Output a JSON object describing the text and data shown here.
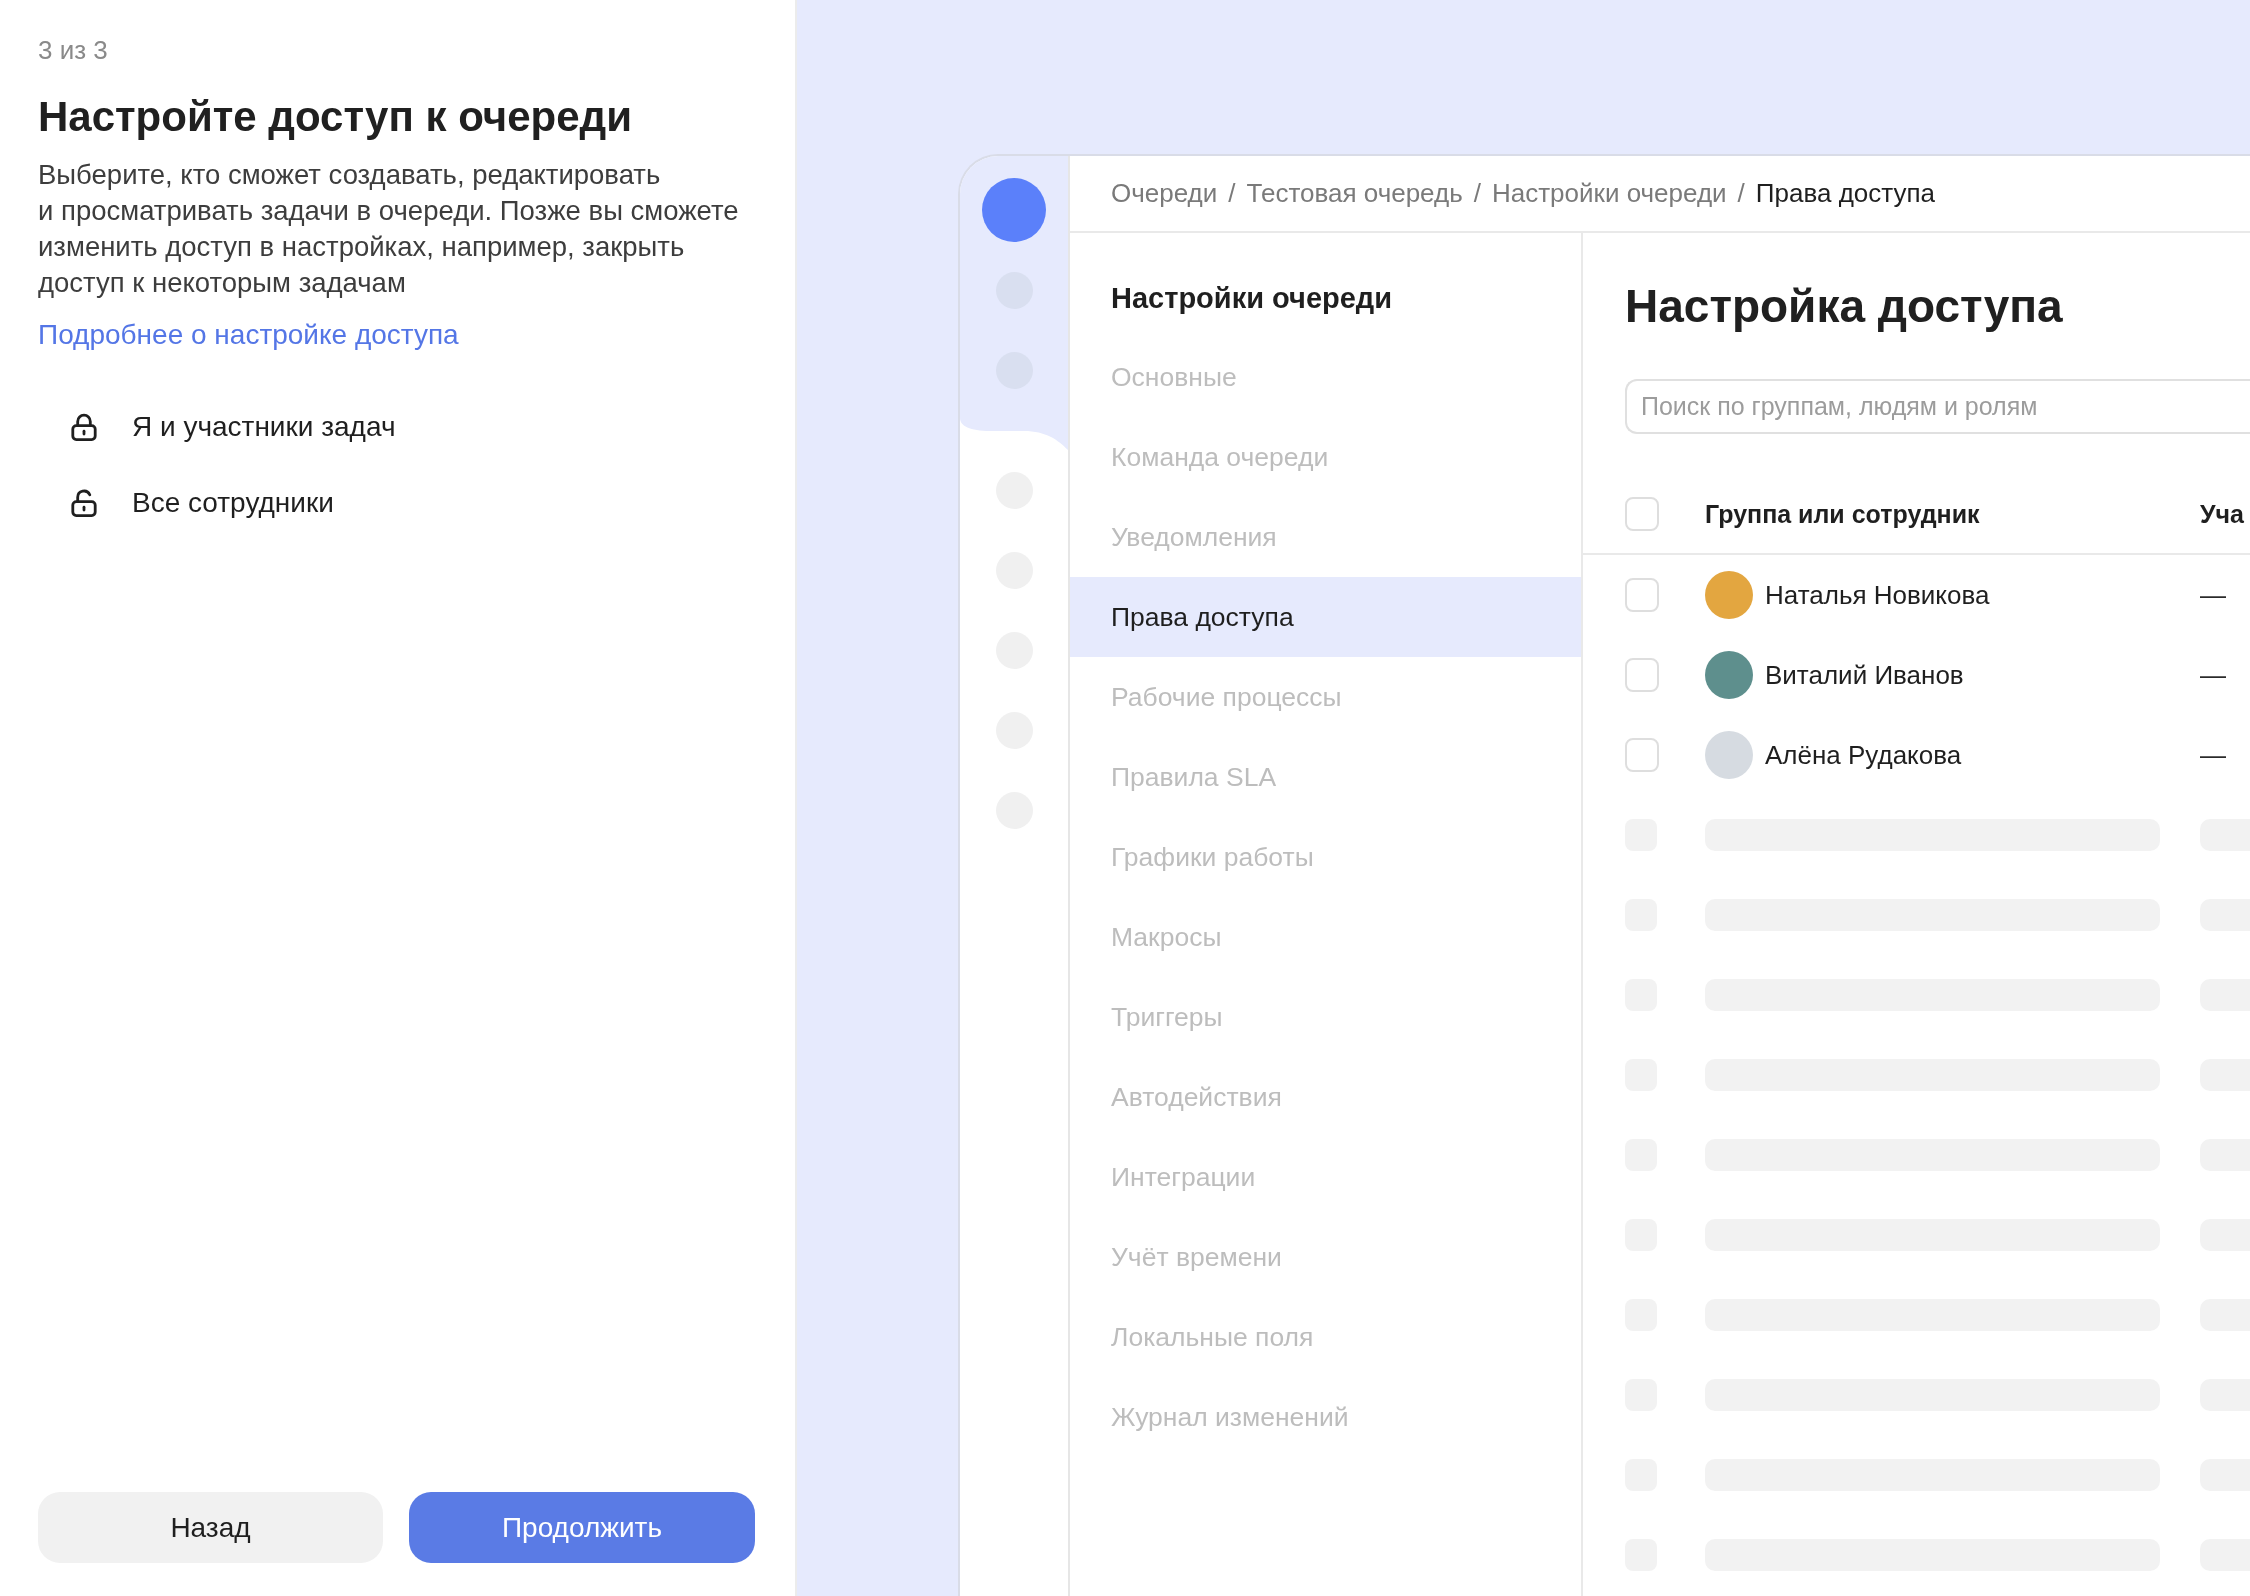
{
  "step": "3 из 3",
  "title": "Настройте доступ к очереди",
  "description": "Выберите, кто сможет создавать, редактировать и просматривать задачи в очереди. Позже вы сможете изменить доступ в настройках, например, закрыть доступ к некоторым задачам",
  "help_link": "Подробнее о настройке доступа",
  "access_options": [
    {
      "label": "Я и участники задач",
      "kind": "locked"
    },
    {
      "label": "Все сотрудники",
      "kind": "unlocked"
    }
  ],
  "buttons": [
    {
      "label": "Назад",
      "kind": "secondary"
    },
    {
      "label": "Продолжить",
      "kind": "primary"
    }
  ],
  "preview": {
    "breadcrumbs": [
      {
        "label": "Очереди",
        "current": false,
        "separator": "/"
      },
      {
        "label": "Тестовая очередь",
        "current": false,
        "separator": "/"
      },
      {
        "label": "Настройки очереди",
        "current": false,
        "separator": "/"
      },
      {
        "label": "Права доступа",
        "current": true
      }
    ],
    "sidebar": {
      "heading": "Настройки очереди",
      "items": [
        {
          "label": "Основные",
          "selected": false
        },
        {
          "label": "Команда очереди",
          "selected": false
        },
        {
          "label": "Уведомления",
          "selected": false
        },
        {
          "label": "Права доступа",
          "selected": true
        },
        {
          "label": "Рабочие процессы",
          "selected": false
        },
        {
          "label": "Правила SLA",
          "selected": false
        },
        {
          "label": "Графики работы",
          "selected": false
        },
        {
          "label": "Макросы",
          "selected": false
        },
        {
          "label": "Триггеры",
          "selected": false
        },
        {
          "label": "Автодействия",
          "selected": false
        },
        {
          "label": "Интеграции",
          "selected": false
        },
        {
          "label": "Учёт времени",
          "selected": false
        },
        {
          "label": "Локальные поля",
          "selected": false
        },
        {
          "label": "Журнал изменений",
          "selected": false
        }
      ]
    },
    "main": {
      "title": "Настройка доступа",
      "search": {
        "placeholder": "Поиск по группам, людям и ролям"
      },
      "table": {
        "header": {
          "checked": false,
          "columns": [
            "Группа или сотрудник",
            "Уча"
          ]
        },
        "rows": [
          {
            "checked": false,
            "color": "#e3a640",
            "name": "Наталья Новикова",
            "column_3": "—"
          },
          {
            "checked": false,
            "color": "#5e8f8d",
            "name": "Виталий Иванов",
            "column_3": "—"
          },
          {
            "checked": false,
            "color": "#d6dbe1",
            "name": "Алёна Рудакова",
            "column_3": "—"
          }
        ]
      }
    }
  }
}
